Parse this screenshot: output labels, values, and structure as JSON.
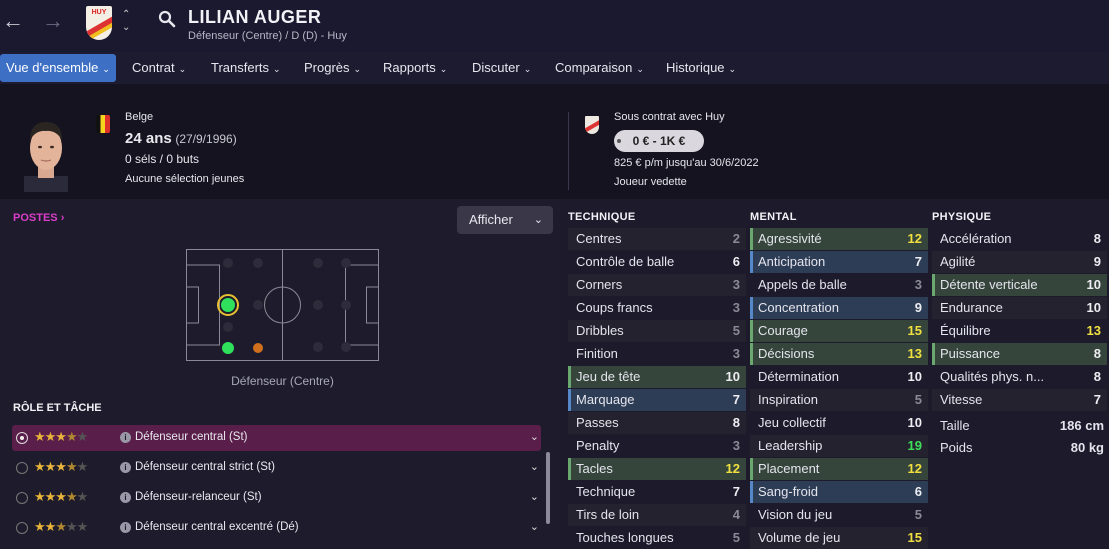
{
  "header": {
    "player_name": "LILIAN AUGER",
    "subtitle": "Défenseur (Centre) / D (D) - Huy",
    "club_badge_text": "HUY"
  },
  "menu": [
    {
      "label": "Vue d'ensemble",
      "active": true
    },
    {
      "label": "Contrat"
    },
    {
      "label": "Transferts"
    },
    {
      "label": "Progrès"
    },
    {
      "label": "Rapports"
    },
    {
      "label": "Discuter"
    },
    {
      "label": "Comparaison"
    },
    {
      "label": "Historique"
    }
  ],
  "profile": {
    "nationality": "Belge",
    "age": "24 ans",
    "birthdate": "(27/9/1996)",
    "caps": "0 séls / 0 buts",
    "youth_caps": "Aucune sélection jeunes"
  },
  "contract": {
    "status": "Sous contrat avec Huy",
    "value": "0 € - 1K €",
    "wage": "825 € p/m jusqu'au 30/6/2022",
    "role": "Joueur vedette"
  },
  "positions": {
    "header": "POSTES",
    "show_button": "Afficher",
    "caption": "Défenseur (Centre)"
  },
  "roles": {
    "header": "RÔLE ET TÂCHE",
    "items": [
      {
        "label": "Défenseur central (St)",
        "stars": 3.5,
        "selected": true
      },
      {
        "label": "Défenseur central strict (St)",
        "stars": 3.5
      },
      {
        "label": "Défenseur-relanceur (St)",
        "stars": 3.5
      },
      {
        "label": "Défenseur central excentré (Dé)",
        "stars": 2.5
      }
    ]
  },
  "technique": {
    "header": "TECHNIQUE",
    "items": [
      {
        "label": "Centres",
        "value": "2",
        "hl": "n"
      },
      {
        "label": "Contrôle de balle",
        "value": "6",
        "hl": ""
      },
      {
        "label": "Corners",
        "value": "3",
        "hl": "n"
      },
      {
        "label": "Coups francs",
        "value": "3",
        "hl": ""
      },
      {
        "label": "Dribbles",
        "value": "5",
        "hl": "n"
      },
      {
        "label": "Finition",
        "value": "3",
        "hl": ""
      },
      {
        "label": "Jeu de tête",
        "value": "10",
        "hl": "g"
      },
      {
        "label": "Marquage",
        "value": "7",
        "hl": "b"
      },
      {
        "label": "Passes",
        "value": "8",
        "hl": "n"
      },
      {
        "label": "Penalty",
        "value": "3",
        "hl": ""
      },
      {
        "label": "Tacles",
        "value": "12",
        "hl": "g"
      },
      {
        "label": "Technique",
        "value": "7",
        "hl": ""
      },
      {
        "label": "Tirs de loin",
        "value": "4",
        "hl": "n"
      },
      {
        "label": "Touches longues",
        "value": "5",
        "hl": ""
      }
    ]
  },
  "mental": {
    "header": "MENTAL",
    "items": [
      {
        "label": "Agressivité",
        "value": "12",
        "hl": "g"
      },
      {
        "label": "Anticipation",
        "value": "7",
        "hl": "b"
      },
      {
        "label": "Appels de balle",
        "value": "3",
        "hl": ""
      },
      {
        "label": "Concentration",
        "value": "9",
        "hl": "b"
      },
      {
        "label": "Courage",
        "value": "15",
        "hl": "g"
      },
      {
        "label": "Décisions",
        "value": "13",
        "hl": "g"
      },
      {
        "label": "Détermination",
        "value": "10",
        "hl": ""
      },
      {
        "label": "Inspiration",
        "value": "5",
        "hl": "n"
      },
      {
        "label": "Jeu collectif",
        "value": "10",
        "hl": ""
      },
      {
        "label": "Leadership",
        "value": "19",
        "hl": "n"
      },
      {
        "label": "Placement",
        "value": "12",
        "hl": "g"
      },
      {
        "label": "Sang-froid",
        "value": "6",
        "hl": "b"
      },
      {
        "label": "Vision du jeu",
        "value": "5",
        "hl": ""
      },
      {
        "label": "Volume de jeu",
        "value": "15",
        "hl": "n"
      }
    ]
  },
  "physique": {
    "header": "PHYSIQUE",
    "items": [
      {
        "label": "Accélération",
        "value": "8",
        "hl": ""
      },
      {
        "label": "Agilité",
        "value": "9",
        "hl": "n"
      },
      {
        "label": "Détente verticale",
        "value": "10",
        "hl": "g"
      },
      {
        "label": "Endurance",
        "value": "10",
        "hl": "n"
      },
      {
        "label": "Équilibre",
        "value": "13",
        "hl": ""
      },
      {
        "label": "Puissance",
        "value": "8",
        "hl": "g"
      },
      {
        "label": "Qualités phys. n...",
        "value": "8",
        "hl": ""
      },
      {
        "label": "Vitesse",
        "value": "7",
        "hl": "n"
      }
    ],
    "height_label": "Taille",
    "height": "186 cm",
    "weight_label": "Poids",
    "weight": "80 kg"
  }
}
